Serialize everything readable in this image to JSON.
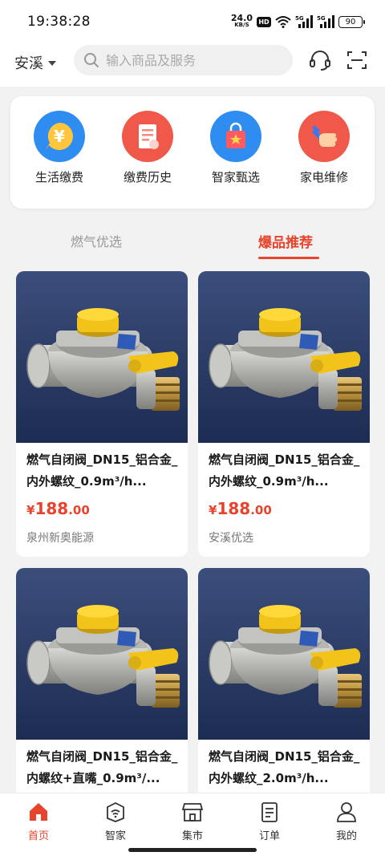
{
  "status_bar": {
    "time": "19:38:28",
    "net_speed_value": "24.0",
    "net_speed_unit": "KB/S",
    "hd": "HD",
    "battery": "90"
  },
  "header": {
    "city": "安溪",
    "search_placeholder": "输入商品及服务",
    "icons": [
      "headset-icon",
      "scan-icon"
    ]
  },
  "quick_actions": [
    {
      "label": "生活缴费",
      "icon": "yen-bubble-icon",
      "color": "#2f8cf0"
    },
    {
      "label": "缴费历史",
      "icon": "receipt-icon",
      "color": "#f0584a"
    },
    {
      "label": "智家甄选",
      "icon": "shopping-bag-icon",
      "color": "#2f8cf0"
    },
    {
      "label": "家电维修",
      "icon": "wrench-hand-icon",
      "color": "#f0584a"
    }
  ],
  "tabs": [
    {
      "label": "燃气优选",
      "active": false
    },
    {
      "label": "爆品推荐",
      "active": true
    }
  ],
  "products": [
    {
      "title": "燃气自闭阀_DN15_铝合金_内外螺纹_0.9m³/h...",
      "price_symbol": "¥",
      "price_int": "188",
      "price_dec": ".00",
      "seller": "泉州新奥能源"
    },
    {
      "title": "燃气自闭阀_DN15_铝合金_内外螺纹_0.9m³/h...",
      "price_symbol": "¥",
      "price_int": "188",
      "price_dec": ".00",
      "seller": "安溪优选"
    },
    {
      "title": "燃气自闭阀_DN15_铝合金_内螺纹+直嘴_0.9m³/...",
      "price_symbol": "",
      "price_int": "",
      "price_dec": "",
      "seller": ""
    },
    {
      "title": "燃气自闭阀_DN15_铝合金_内外螺纹_2.0m³/h...",
      "price_symbol": "",
      "price_int": "",
      "price_dec": "",
      "seller": ""
    }
  ],
  "bottom_nav": [
    {
      "label": "首页",
      "icon": "home-icon",
      "active": true
    },
    {
      "label": "智家",
      "icon": "smart-home-icon",
      "active": false
    },
    {
      "label": "集市",
      "icon": "store-icon",
      "active": false
    },
    {
      "label": "订单",
      "icon": "order-icon",
      "active": false
    },
    {
      "label": "我的",
      "icon": "profile-icon",
      "active": false
    }
  ],
  "colors": {
    "accent": "#e8432c",
    "background": "#f2f2f2"
  }
}
